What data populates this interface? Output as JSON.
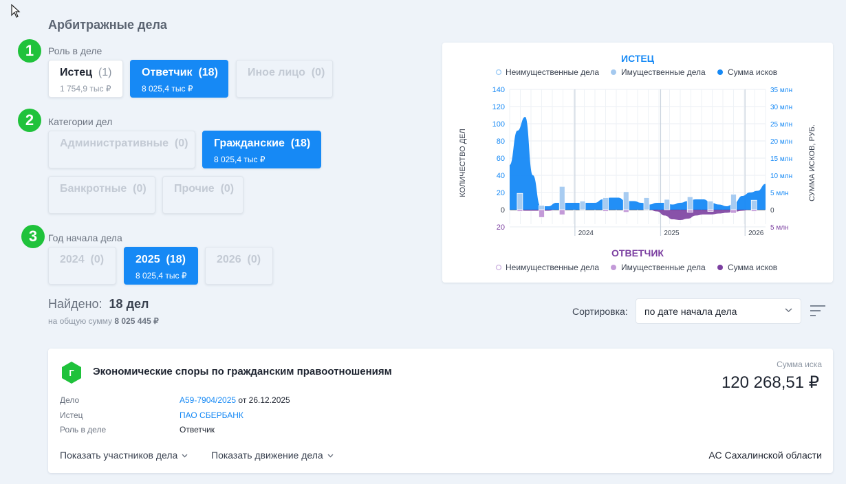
{
  "page_title": "Арбитражные дела",
  "steps": [
    "1",
    "2",
    "3"
  ],
  "role": {
    "label": "Роль в деле",
    "chips": [
      {
        "name": "Истец",
        "count": "(1)",
        "sub": "1 754,9 тыс ₽"
      },
      {
        "name": "Ответчик",
        "count": "(18)",
        "sub": "8 025,4 тыс ₽"
      },
      {
        "name": "Иное лицо",
        "count": "(0)",
        "sub": ""
      }
    ]
  },
  "categories": {
    "label": "Категории дел",
    "chips": [
      {
        "name": "Административные",
        "count": "(0)",
        "sub": ""
      },
      {
        "name": "Гражданские",
        "count": "(18)",
        "sub": "8 025,4 тыс ₽"
      },
      {
        "name": "Банкротные",
        "count": "(0)",
        "sub": ""
      },
      {
        "name": "Прочие",
        "count": "(0)",
        "sub": ""
      }
    ]
  },
  "years": {
    "label": "Год начала дела",
    "chips": [
      {
        "name": "2024",
        "count": "(0)",
        "sub": ""
      },
      {
        "name": "2025",
        "count": "(18)",
        "sub": "8 025,4 тыс ₽"
      },
      {
        "name": "2026",
        "count": "(0)",
        "sub": ""
      }
    ]
  },
  "found": {
    "label": "Найдено:",
    "value": "18 дел",
    "sub_label": "на общую сумму",
    "sub_value": "8 025 445 ₽"
  },
  "sort": {
    "label": "Сортировка:",
    "value": "по дате начала дела"
  },
  "chart_data": {
    "type": "area",
    "top_title": "ИСТЕЦ",
    "bottom_title": "ОТВЕТЧИК",
    "top_legend": [
      "Неимущественные дела",
      "Имущественные дела",
      "Сумма исков"
    ],
    "bottom_legend": [
      "Неимущественные дела",
      "Имущественные дела",
      "Сумма исков"
    ],
    "ylabel_left": "КОЛИЧЕСТВО ДЕЛ",
    "ylabel_right": "СУММА ИСКОВ, РУБ.",
    "left_ticks": [
      "140",
      "120",
      "100",
      "80",
      "60",
      "40",
      "20",
      "0",
      "20"
    ],
    "right_ticks": [
      "35 млн",
      "30 млн",
      "25 млн",
      "20 млн",
      "15 млн",
      "10 млн",
      "5 млн",
      "0",
      "5 млн"
    ],
    "x_ticks": [
      "2024",
      "2025",
      "2026"
    ],
    "ylim_left": [
      -20,
      140
    ],
    "ylim_right": [
      -5,
      35
    ],
    "plaintiff_sum_mln": [
      13,
      23,
      27,
      10,
      1,
      1,
      2,
      2,
      2,
      2,
      2,
      2,
      3,
      3.5,
      3.5,
      2.5,
      2.5,
      2,
      1.5,
      2,
      2,
      1.5,
      2,
      2.5,
      3,
      3,
      2,
      1.5,
      1,
      2,
      4,
      5,
      5.5,
      7.5
    ],
    "defendant_sum_mln": [
      0,
      0,
      -0.3,
      -0.3,
      -0.3,
      -0.3,
      0,
      0,
      0,
      0,
      0,
      0,
      0,
      0,
      0,
      0,
      0,
      0,
      0,
      -0.5,
      -1.7,
      -2.8,
      -3,
      -2.6,
      -1.7,
      -1.4,
      -1.4,
      -1.1,
      -0.9,
      -0.6,
      -0.3,
      0,
      0,
      0
    ],
    "bars": [
      {
        "top": 19,
        "bottom": -2
      },
      {
        "top": 5,
        "bottom": -9
      },
      {
        "top": 27,
        "bottom": -6
      },
      {
        "top": 10,
        "bottom": 0
      },
      {
        "top": 14,
        "bottom": -2
      },
      {
        "top": 21,
        "bottom": -3
      },
      {
        "top": 14,
        "bottom": 0
      },
      {
        "top": 12,
        "bottom": 0
      },
      {
        "top": 15,
        "bottom": -3
      },
      {
        "top": 10,
        "bottom": -2
      },
      {
        "top": 18,
        "bottom": -4
      },
      {
        "top": 11,
        "bottom": -2
      }
    ]
  },
  "case": {
    "badge": "Г",
    "title": "Экономические споры по гражданским правоотношениям",
    "sum_label": "Сумма иска",
    "sum_value": "120 268,51 ₽",
    "rows": [
      {
        "label": "Дело",
        "value_link": "А59-7904/2025",
        "value_rest": " от 26.12.2025"
      },
      {
        "label": "Истец",
        "value_link": "ПАО СБЕРБАНК",
        "value_rest": ""
      },
      {
        "label": "Роль в деле",
        "value_link": "",
        "value_rest": "Ответчик"
      }
    ],
    "show_participants": "Показать участников дела",
    "show_movement": "Показать движение дела",
    "court": "АС Сахалинской области"
  },
  "colors": {
    "accent": "#1689f5",
    "step": "#1fc23b",
    "defendant": "#7b3fa0"
  }
}
